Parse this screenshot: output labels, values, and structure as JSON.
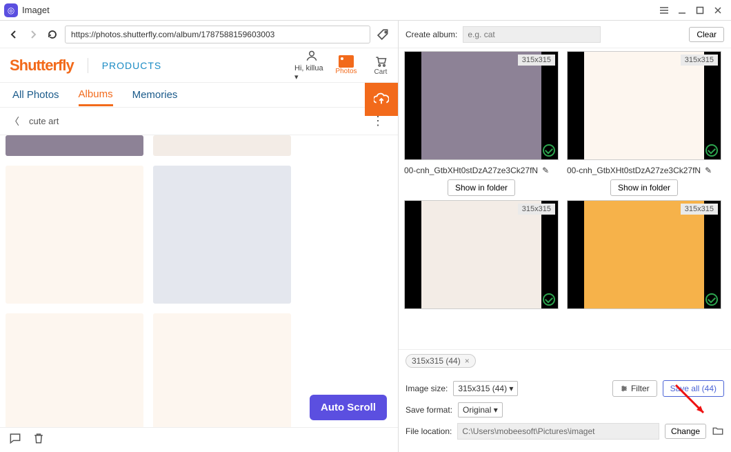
{
  "app": {
    "title": "Imaget"
  },
  "address_bar": {
    "url": "https://photos.shutterfly.com/album/1787588159603003"
  },
  "site": {
    "logo_text": "Shutterfly",
    "products": "PRODUCTS",
    "greeting": "Hi, killua ▾",
    "photos_label": "Photos",
    "cart_label": "Cart"
  },
  "tabs": {
    "all_photos": "All Photos",
    "albums": "Albums",
    "memories": "Memories"
  },
  "breadcrumb": {
    "label": "cute art"
  },
  "auto_scroll": "Auto Scroll",
  "create_album": {
    "label": "Create album:",
    "placeholder": "e.g. cat",
    "clear": "Clear"
  },
  "cards": [
    {
      "size": "315x315",
      "filename": "00-cnh_GtbXHt0stDzA27ze3Ck27fN",
      "show": "Show in folder"
    },
    {
      "size": "315x315",
      "filename": "00-cnh_GtbXHt0stDzA27ze3Ck27fN",
      "show": "Show in folder"
    },
    {
      "size": "315x315",
      "filename": "",
      "show": ""
    },
    {
      "size": "315x315",
      "filename": "",
      "show": ""
    }
  ],
  "chip": {
    "label": "315x315 (44)"
  },
  "controls": {
    "image_size_label": "Image size:",
    "image_size_value": "315x315 (44) ▾",
    "filter": "Filter",
    "save_all": "Save all (44)",
    "save_format_label": "Save format:",
    "save_format_value": "Original ▾",
    "file_location_label": "File location:",
    "file_location_value": "C:\\Users\\mobeesoft\\Pictures\\imaget",
    "change": "Change"
  }
}
